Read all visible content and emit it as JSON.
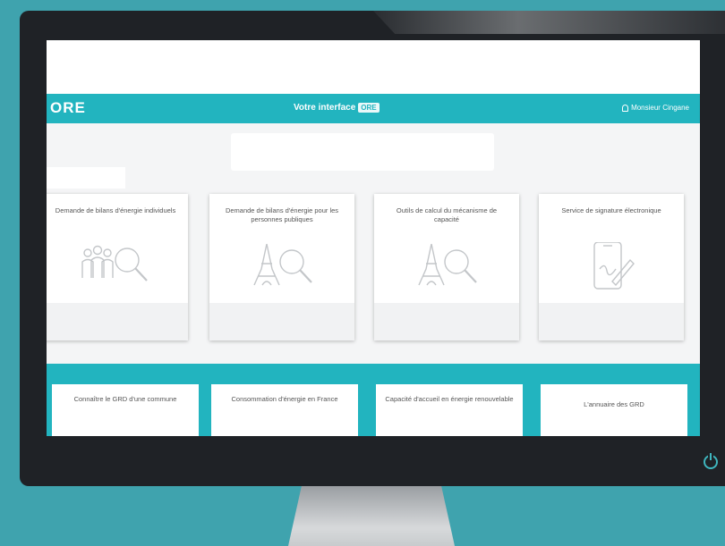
{
  "header": {
    "logo": "ORE",
    "title": "Votre interface",
    "title_badge": "ORE",
    "user_name": "Monsieur Cingane"
  },
  "cards": [
    {
      "title": "Demande de bilans d'énergie individuels",
      "icon": "people-search-icon"
    },
    {
      "title": "Demande de bilans d'énergie pour les personnes publiques",
      "icon": "eiffel-search-icon"
    },
    {
      "title": "Outils de calcul du mécanisme de capacité",
      "icon": "eiffel-search-icon"
    },
    {
      "title": "Service de signature électronique",
      "icon": "tablet-signature-icon"
    }
  ],
  "tiles": [
    {
      "label": "Connaître le GRD d'une commune"
    },
    {
      "label": "Consommation d'énergie en France"
    },
    {
      "label": "Capacité d'accueil en énergie renouvelable"
    },
    {
      "label": "L'annuaire des GRD"
    }
  ],
  "colors": {
    "accent": "#22b4bf",
    "background": "#3fa3ae",
    "bezel": "#1f2226"
  }
}
